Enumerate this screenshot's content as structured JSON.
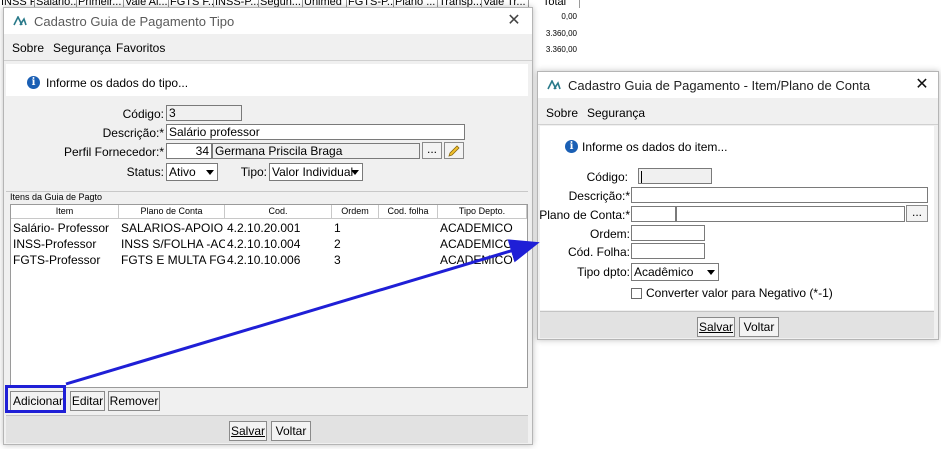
{
  "background": {
    "columns": [
      "INSS F...",
      "Salário...",
      "Primeir...",
      "Vale Al...",
      "FGTS F...",
      "INSS-P...",
      "Segun...",
      "Unimed",
      "FGTS-P...",
      "Plano ...",
      "Transp...",
      "Vale Tr...",
      "Total"
    ],
    "totals": [
      "0,00",
      "3.360,00",
      "3.360,00"
    ]
  },
  "win1": {
    "title": "Cadastro Guia de Pagamento Tipo",
    "menu": [
      "Sobre",
      "Segurança",
      "Favoritos"
    ],
    "info_text": "Informe os dados do tipo...",
    "form": {
      "codigo_label": "Código:",
      "codigo_value": "3",
      "descricao_label": "Descrição:*",
      "descricao_value": "Salário professor",
      "perfil_label": "Perfil Fornecedor:*",
      "perfil_code": "34",
      "perfil_name": "Germana Priscila Braga",
      "perfil_btn": "...",
      "status_label": "Status:",
      "status_value": "Ativo",
      "tipo_label": "Tipo:",
      "tipo_value": "Valor Individual"
    },
    "grid_title": "Itens da Guia de Pagto",
    "grid_headers": [
      "Item",
      "Plano de Conta",
      "Cod.",
      "Ordem",
      "Cod. folha",
      "Tipo Depto."
    ],
    "grid_rows": [
      [
        "Salário- Professor",
        "SALARIOS-APOIO A...",
        "4.2.10.20.001",
        "1",
        "",
        "ACADEMICO"
      ],
      [
        "INSS-Professor",
        "INSS S/FOLHA -AC...",
        "4.2.10.10.004",
        "2",
        "",
        "ACADEMICO"
      ],
      [
        "FGTS-Professor",
        "FGTS E MULTA FGT...",
        "4.2.10.10.006",
        "3",
        "",
        "ACADEMICO"
      ]
    ],
    "buttons": {
      "adicionar": "Adicionar",
      "editar": "Editar",
      "remover": "Remover",
      "salvar": "Salvar",
      "voltar": "Voltar"
    }
  },
  "win2": {
    "title": "Cadastro Guia de Pagamento - Item/Plano de Conta",
    "menu": [
      "Sobre",
      "Segurança"
    ],
    "info_text": "Informe os dados do item...",
    "form": {
      "codigo_label": "Código:",
      "codigo_value": "",
      "descricao_label": "Descrição:*",
      "descricao_value": "",
      "plano_label": "Plano de Conta:*",
      "plano_btn": "...",
      "ordem_label": "Ordem:",
      "codfolha_label": "Cód. Folha:",
      "tipodpto_label": "Tipo dpto:",
      "tipodpto_value": "Acadêmico",
      "checkbox_label": "Converter valor para Negativo (*-1)"
    },
    "buttons": {
      "salvar": "Salvar",
      "voltar": "Voltar"
    }
  },
  "annotation_color": "#1f1fd6"
}
